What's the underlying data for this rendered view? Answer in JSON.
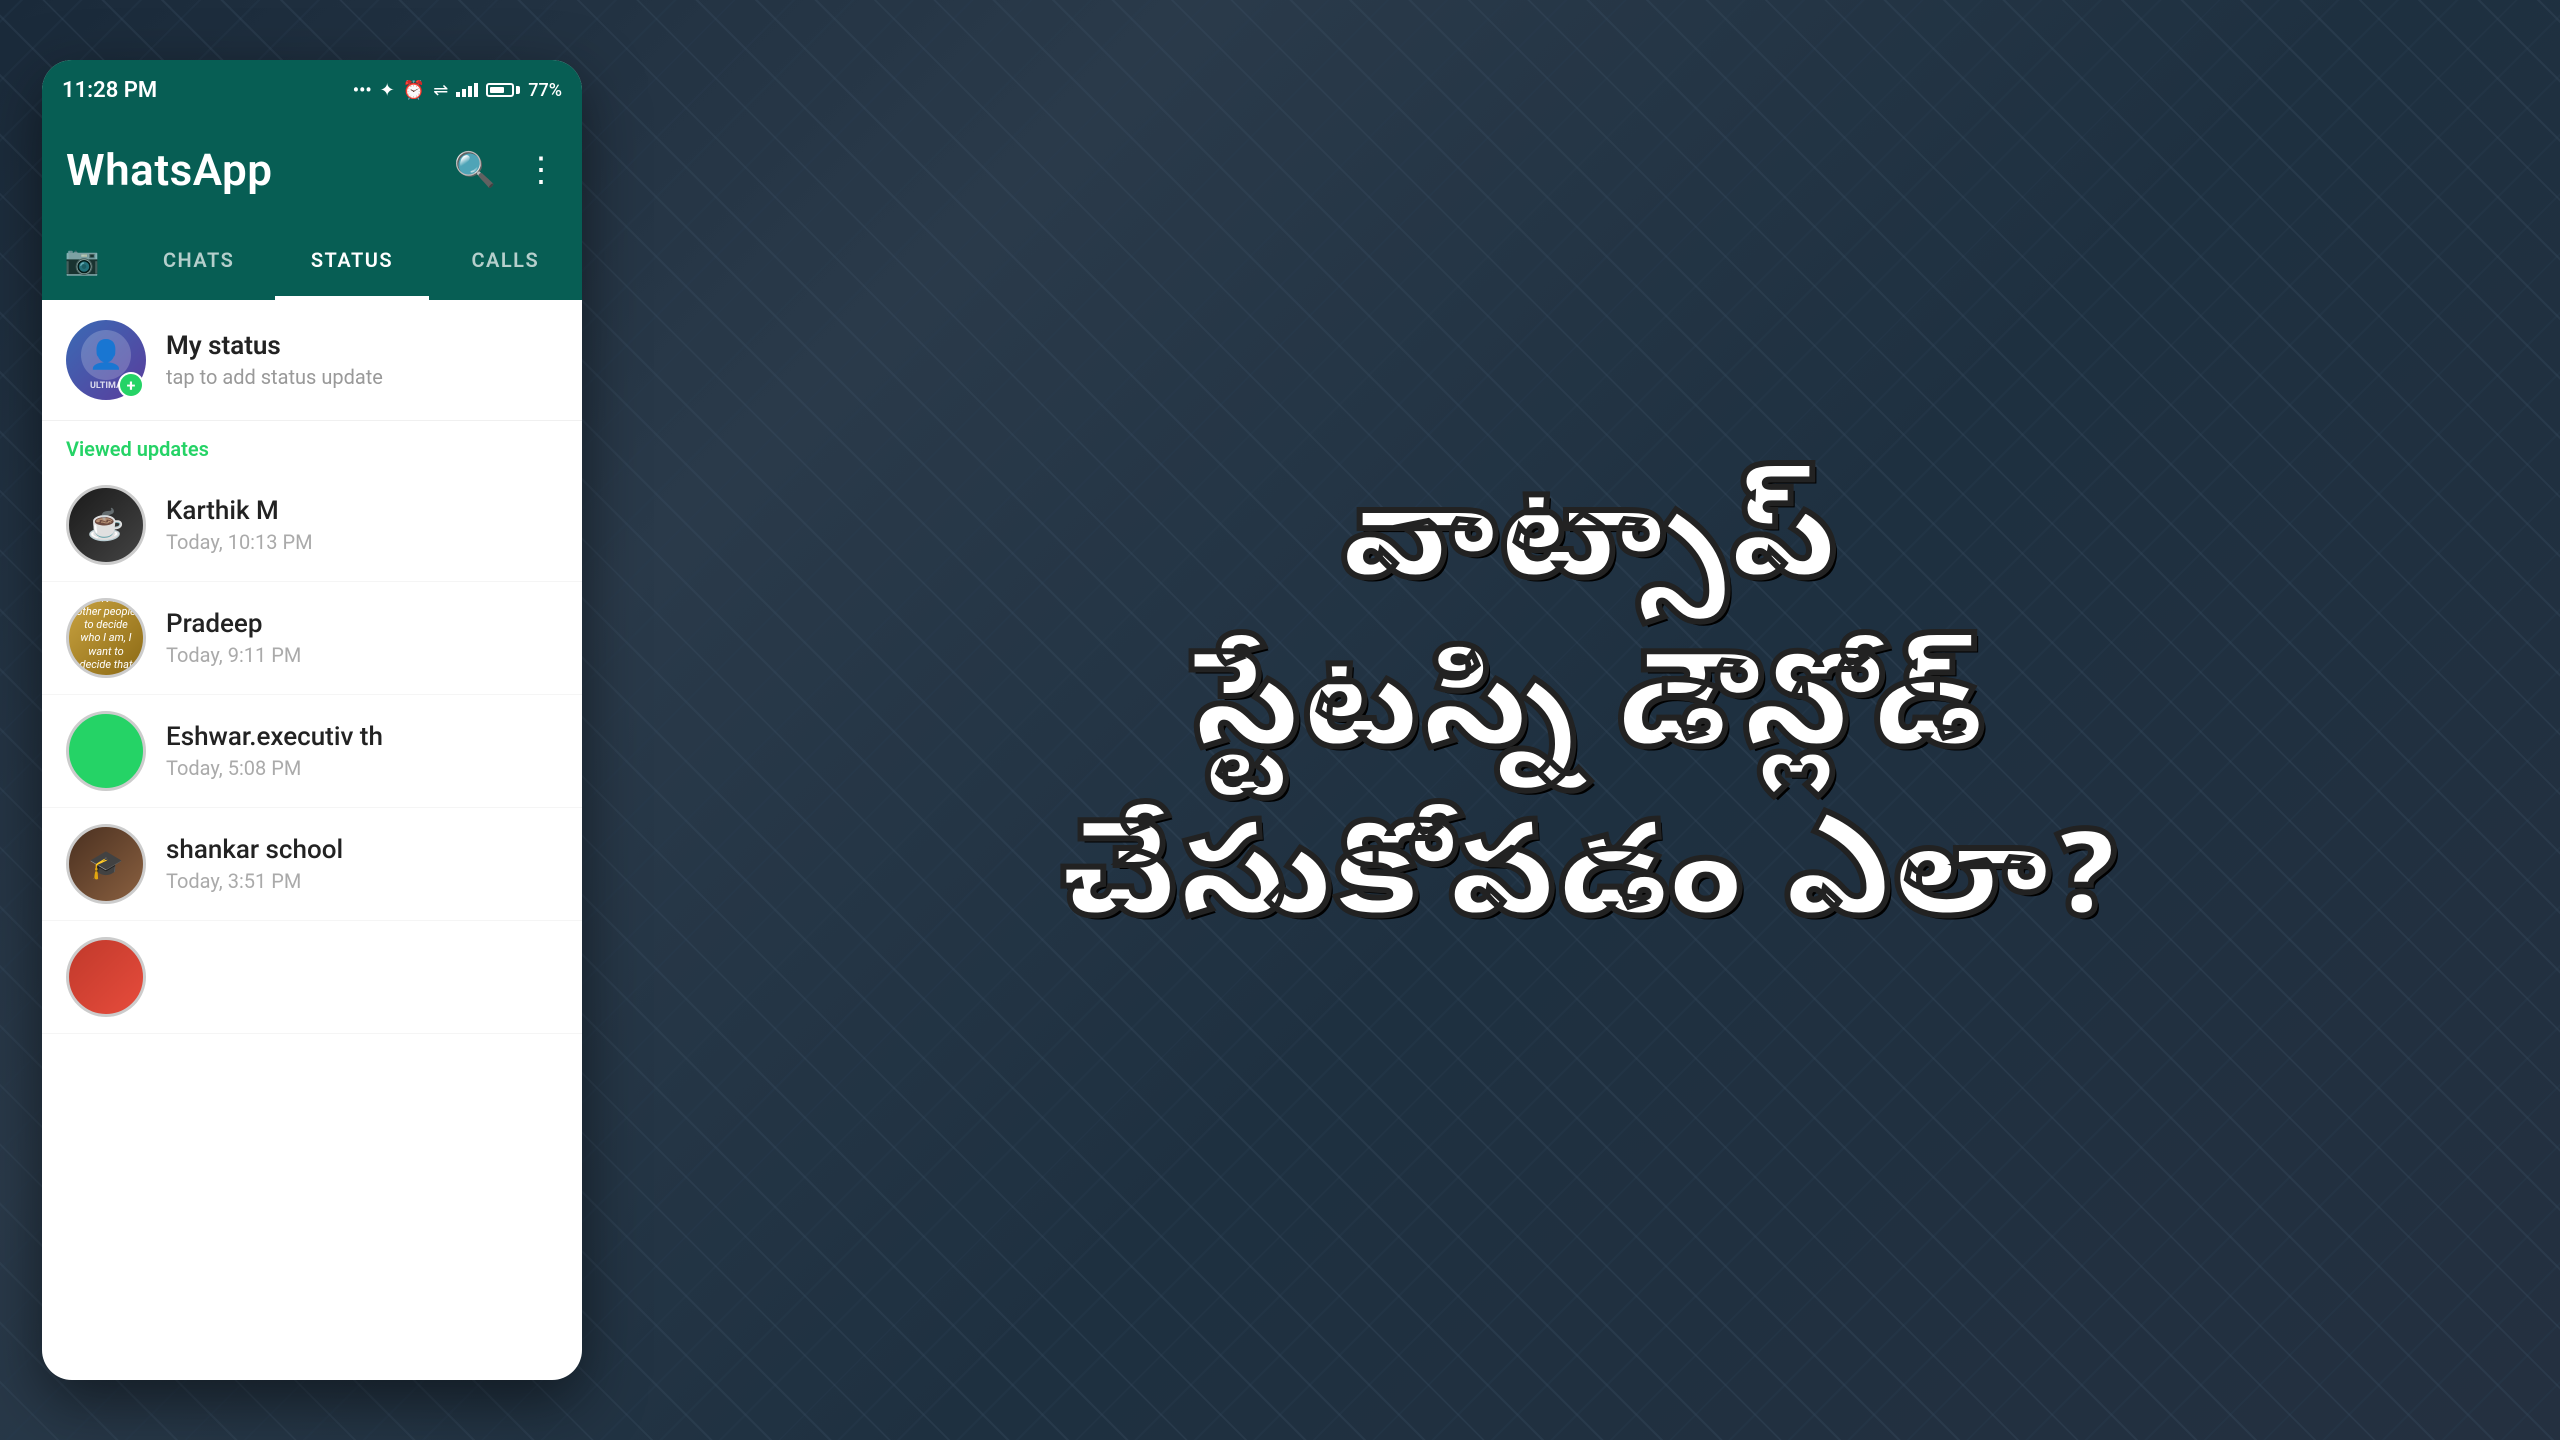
{
  "background": {
    "color": "#2a3a4a"
  },
  "statusBar": {
    "time": "11:28 PM",
    "battery": "77%",
    "icons": "... ✦ ⏰ ⇌ ▲"
  },
  "header": {
    "title": "WhatsApp",
    "searchIcon": "🔍",
    "menuIcon": "⋮"
  },
  "tabs": [
    {
      "id": "camera",
      "label": "📷",
      "isCamera": true
    },
    {
      "id": "chats",
      "label": "CHATS",
      "active": false
    },
    {
      "id": "status",
      "label": "STATUS",
      "active": true
    },
    {
      "id": "calls",
      "label": "CALLS",
      "active": false
    }
  ],
  "myStatus": {
    "name": "My status",
    "subtitle": "tap to add status update"
  },
  "viewedUpdates": {
    "sectionTitle": "Viewed updates",
    "items": [
      {
        "id": "karthik",
        "name": "Karthik M",
        "time": "Today, 10:13 PM"
      },
      {
        "id": "pradeep",
        "name": "Pradeep",
        "time": "Today, 9:11 PM"
      },
      {
        "id": "eshwar",
        "name": "Eshwar.executiv th",
        "time": "Today, 5:08 PM"
      },
      {
        "id": "shankar",
        "name": "shankar school",
        "time": "Today, 3:51 PM"
      }
    ]
  },
  "teluguOverlay": {
    "line1": "వాట్సాప్",
    "line2": "స్టేటస్ని డౌన్లోడ్",
    "line3": "చేసుకోవడం ఎలా?"
  }
}
